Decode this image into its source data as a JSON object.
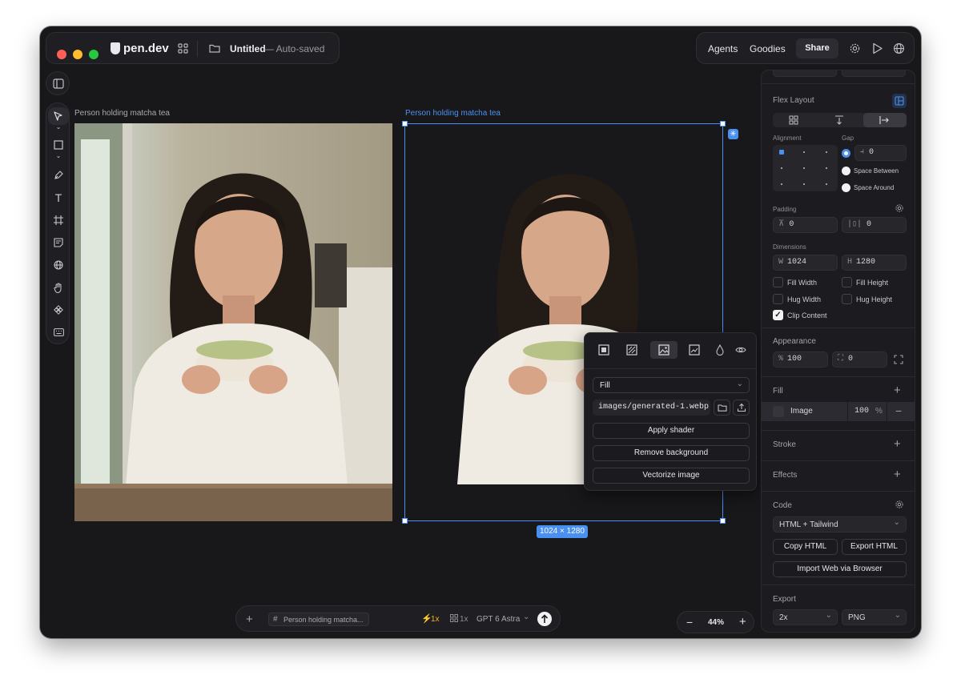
{
  "topbar": {
    "brand": "pen.dev",
    "file_title": "Untitled",
    "file_status": "— Auto-saved",
    "agents": "Agents",
    "goodies": "Goodies",
    "share": "Share"
  },
  "canvas": {
    "left_frame_label": "Person holding matcha tea",
    "right_frame_label": "Person holding matcha tea",
    "size_badge": "1024 × 1280"
  },
  "image_popup": {
    "fit_mode": "Fill",
    "path": "images/generated-1.webp",
    "apply_shader": "Apply shader",
    "remove_background": "Remove background",
    "vectorize_image": "Vectorize image"
  },
  "panel": {
    "flex_layout": "Flex Layout",
    "alignment": "Alignment",
    "gap": "Gap",
    "gap_value": "0",
    "space_between": "Space Between",
    "space_around": "Space Around",
    "padding": "Padding",
    "padding_v": "0",
    "padding_h": "0",
    "dimensions": "Dimensions",
    "w_label": "W",
    "w_value": "1024",
    "h_label": "H",
    "h_value": "1280",
    "fill_width": "Fill Width",
    "fill_height": "Fill Height",
    "hug_width": "Hug Width",
    "hug_height": "Hug Height",
    "clip_content": "Clip Content",
    "appearance": "Appearance",
    "opacity_unit": "%",
    "opacity_value": "100",
    "radius_value": "0",
    "fill": "Fill",
    "fill_type": "Image",
    "fill_opacity": "100",
    "fill_unit": "%",
    "stroke": "Stroke",
    "effects": "Effects",
    "code": "Code",
    "code_format": "HTML + Tailwind",
    "copy_html": "Copy HTML",
    "export_html": "Export HTML",
    "import_web": "Import Web via Browser",
    "export": "Export",
    "export_scale": "2x",
    "export_format": "PNG"
  },
  "prompt_bar": {
    "context_chip": "Person holding matcha...",
    "speed": "1x",
    "count": "1x",
    "model": "GPT 6 Astra"
  },
  "zoom": {
    "minus": "−",
    "value": "44%",
    "plus": "+"
  },
  "colors": {
    "accent": "#4a90f0",
    "window_bg": "#18181b",
    "panel_bg": "#1c1c20"
  }
}
